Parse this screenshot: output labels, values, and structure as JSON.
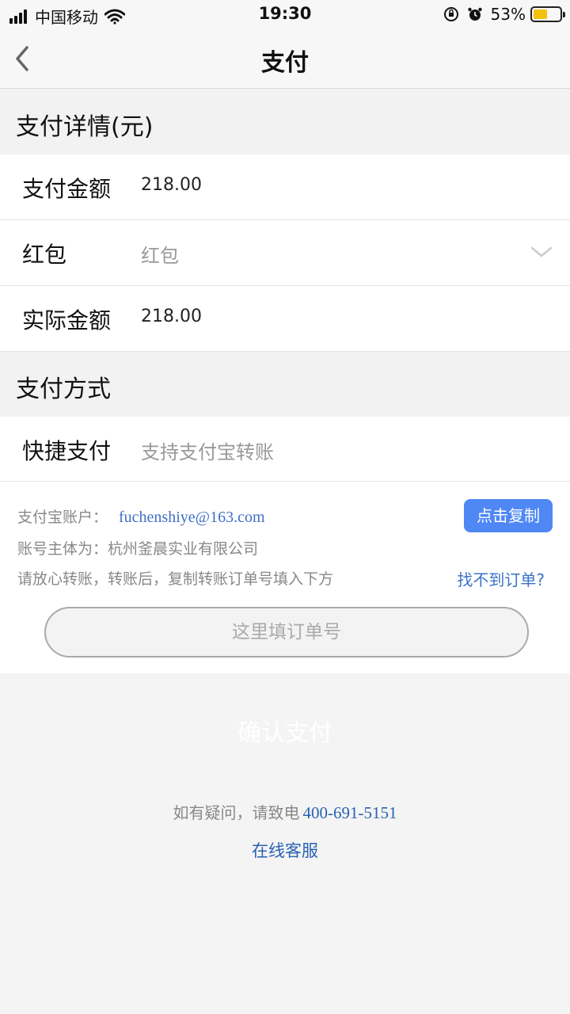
{
  "status_bar": {
    "carrier": "中国移动",
    "time": "19:30",
    "battery_percent": "53%",
    "battery_level": 0.53,
    "icons": [
      "signal-icon",
      "wifi-icon",
      "rotation-lock-icon",
      "alarm-icon",
      "battery-icon"
    ]
  },
  "nav": {
    "title": "支付",
    "back_icon": "chevron-left-icon"
  },
  "details": {
    "header": "支付详情(元)",
    "rows": [
      {
        "label": "支付金额",
        "value": "218.00"
      },
      {
        "label": "红包",
        "placeholder": "红包",
        "icon": "chevron-down-icon"
      },
      {
        "label": "实际金额",
        "value": "218.00"
      }
    ]
  },
  "method": {
    "header": "支付方式",
    "label": "快捷支付",
    "value": "支持支付宝转账"
  },
  "transfer": {
    "account_label": "支付宝账户：",
    "account_email": "fuchenshiye@163.com",
    "copy_button": "点击复制",
    "owner_text": "账号主体为：杭州釜晨实业有限公司",
    "instruction": "请放心转账，转账后，复制转账订单号填入下方",
    "not_found_link": "找不到订单?",
    "order_placeholder": "这里填订单号"
  },
  "confirm_button": "确认支付",
  "help": {
    "text": "如有疑问，请致电",
    "phone": "400-691-5151",
    "online_service": "在线客服"
  },
  "colors": {
    "accent": "#4f88f5",
    "link": "#2a62b3",
    "battery": "#f4c20d"
  }
}
